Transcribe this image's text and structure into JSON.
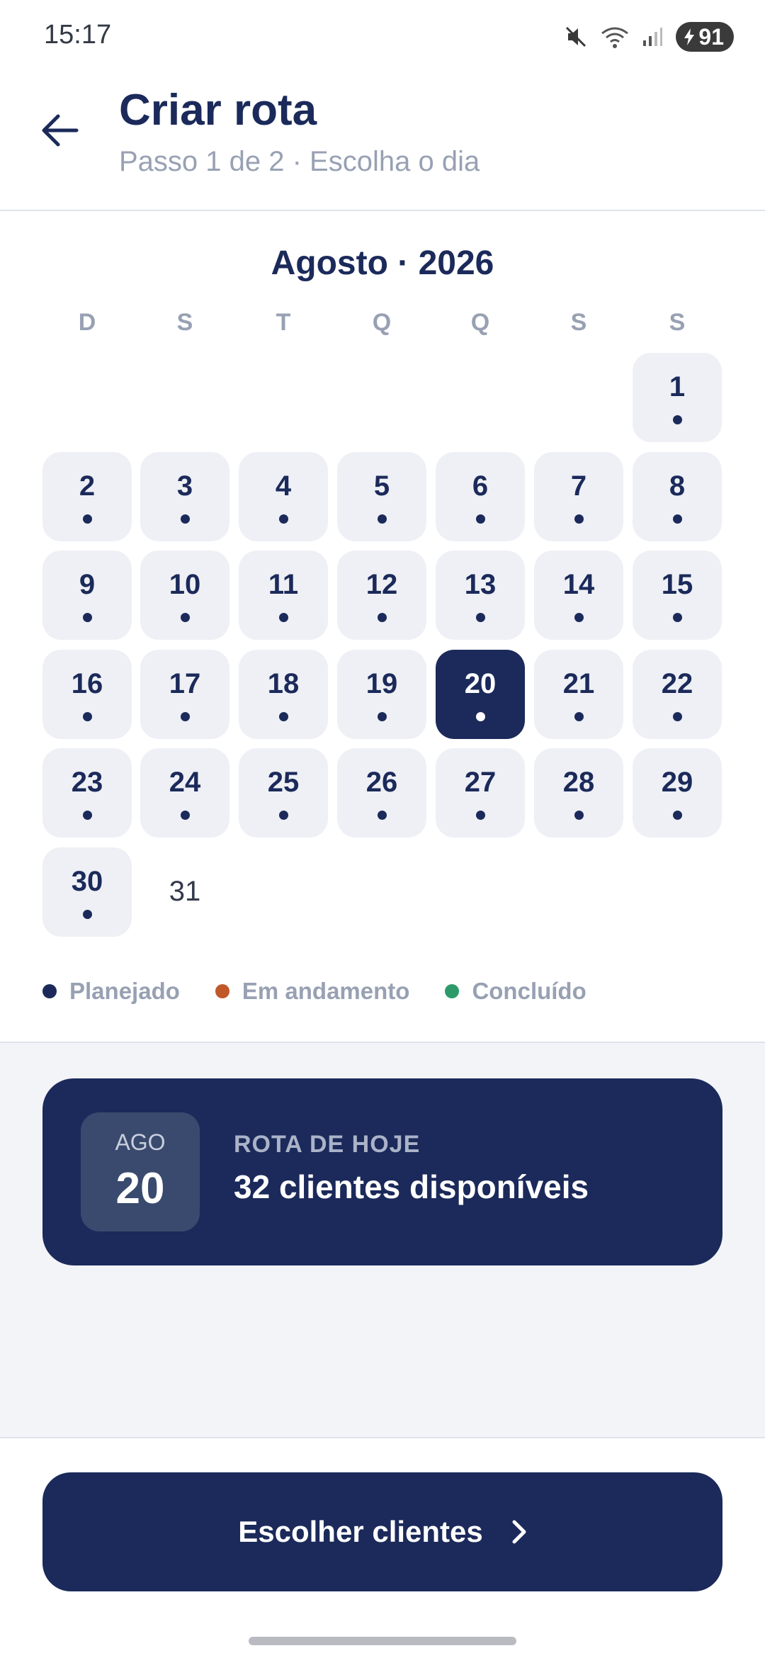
{
  "status_bar": {
    "time": "15:17",
    "battery": "91",
    "icons": [
      "mute-icon",
      "wifi-icon",
      "signal-icon",
      "battery-icon"
    ]
  },
  "header": {
    "title": "Criar rota",
    "subtitle": "Passo 1 de 2 · Escolha o dia",
    "back_icon": "arrow-left-icon"
  },
  "calendar": {
    "month_label": "Agosto · 2026",
    "weekdays": [
      "D",
      "S",
      "T",
      "Q",
      "Q",
      "S",
      "S"
    ],
    "days": [
      {
        "label": "1",
        "status": "planejado"
      },
      {
        "label": "2",
        "status": "planejado"
      },
      {
        "label": "3",
        "status": "planejado"
      },
      {
        "label": "4",
        "status": "planejado"
      },
      {
        "label": "5",
        "status": "planejado"
      },
      {
        "label": "6",
        "status": "planejado"
      },
      {
        "label": "7",
        "status": "planejado"
      },
      {
        "label": "8",
        "status": "planejado"
      },
      {
        "label": "9",
        "status": "planejado"
      },
      {
        "label": "10",
        "status": "planejado"
      },
      {
        "label": "11",
        "status": "planejado"
      },
      {
        "label": "12",
        "status": "planejado"
      },
      {
        "label": "13",
        "status": "planejado"
      },
      {
        "label": "14",
        "status": "planejado"
      },
      {
        "label": "15",
        "status": "planejado"
      },
      {
        "label": "16",
        "status": "planejado"
      },
      {
        "label": "17",
        "status": "planejado"
      },
      {
        "label": "18",
        "status": "planejado"
      },
      {
        "label": "19",
        "status": "planejado"
      },
      {
        "label": "20",
        "status": "planejado",
        "selected": true
      },
      {
        "label": "21",
        "status": "planejado"
      },
      {
        "label": "22",
        "status": "planejado"
      },
      {
        "label": "23",
        "status": "planejado"
      },
      {
        "label": "24",
        "status": "planejado"
      },
      {
        "label": "25",
        "status": "planejado"
      },
      {
        "label": "26",
        "status": "planejado"
      },
      {
        "label": "27",
        "status": "planejado"
      },
      {
        "label": "28",
        "status": "planejado"
      },
      {
        "label": "29",
        "status": "planejado"
      },
      {
        "label": "30",
        "status": "planejado"
      },
      {
        "label": "31",
        "status": "none"
      }
    ],
    "legend": [
      {
        "label": "Planejado",
        "color": "#1b2a5a"
      },
      {
        "label": "Em andamento",
        "color": "#c0582a"
      },
      {
        "label": "Concluído",
        "color": "#2e9a6a"
      }
    ]
  },
  "today_card": {
    "month": "AGO",
    "day": "20",
    "label": "ROTA DE HOJE",
    "text": "32 clientes disponíveis"
  },
  "cta": {
    "label": "Escolher clientes",
    "icon": "chevron-right-icon"
  },
  "colors": {
    "primary": "#1b2a5a",
    "muted": "#98a1b3",
    "day_bg": "#eef0f5"
  }
}
